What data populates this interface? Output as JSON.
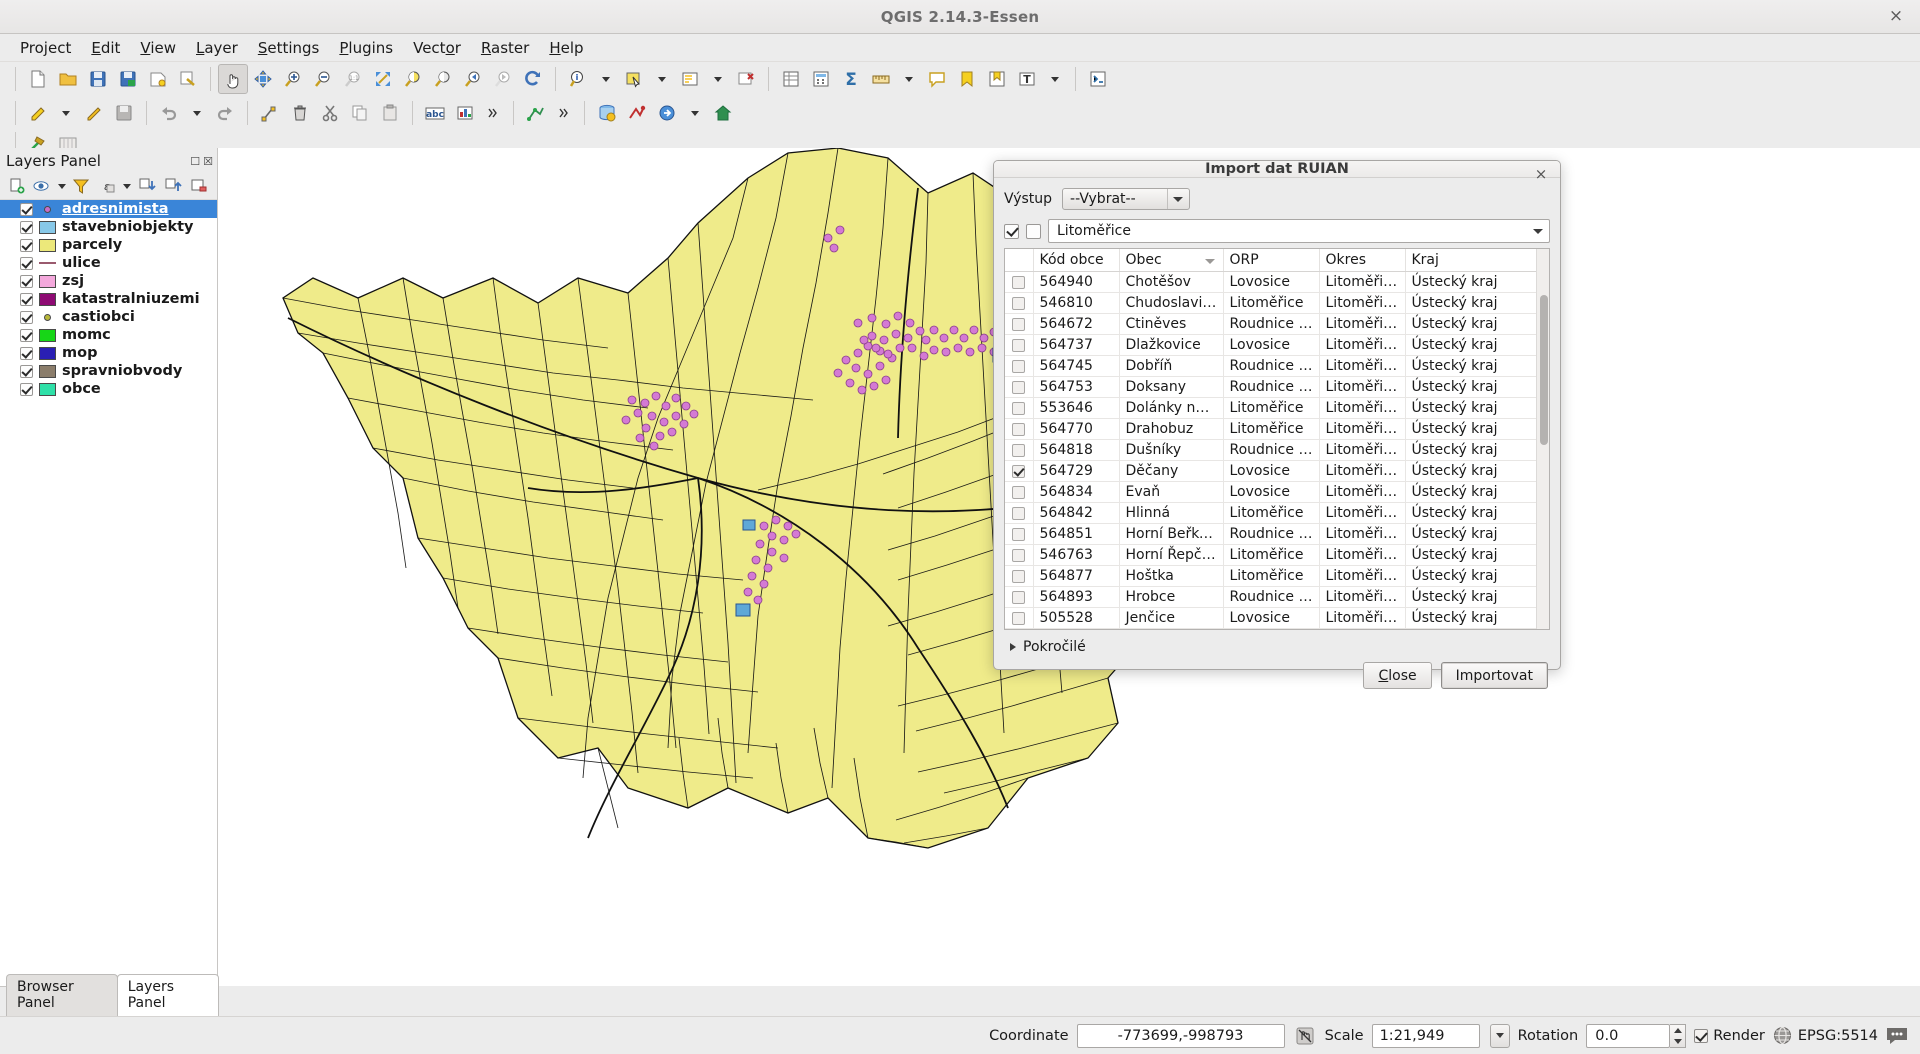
{
  "window": {
    "title": "QGIS 2.14.3-Essen",
    "close_label": "×"
  },
  "menubar": {
    "items": [
      {
        "label": "Project",
        "accel": "j"
      },
      {
        "label": "Edit",
        "accel": "E"
      },
      {
        "label": "View",
        "accel": "V"
      },
      {
        "label": "Layer",
        "accel": "L"
      },
      {
        "label": "Settings",
        "accel": "S"
      },
      {
        "label": "Plugins",
        "accel": "P"
      },
      {
        "label": "Vector",
        "accel": "o"
      },
      {
        "label": "Raster",
        "accel": "R"
      },
      {
        "label": "Help",
        "accel": "H"
      }
    ]
  },
  "toolbar_row1": {
    "icons": [
      "new-project-icon",
      "open-project-icon",
      "save-project-icon",
      "save-project-as-icon",
      "new-print-composer-icon",
      "composer-manager-icon",
      "pan-map-icon",
      "pan-to-selection-icon",
      "zoom-in-icon",
      "zoom-out-icon",
      "zoom-full-icon",
      "zoom-native-icon",
      "zoom-to-selection-icon",
      "zoom-to-layer-icon",
      "zoom-last-icon",
      "zoom-next-icon",
      "refresh-icon",
      "identify-features-icon",
      "measure-icon",
      "select-features-icon",
      "deselect-icon",
      "open-attribute-table-icon",
      "open-field-calculator-icon",
      "statistical-summary-icon",
      "measure-line-icon",
      "map-tips-icon",
      "new-bookmark-icon",
      "show-bookmarks-icon",
      "text-annotation-icon",
      "python-console-icon"
    ]
  },
  "toolbar_row2": {
    "icons": [
      "current-edits-icon",
      "toggle-editing-icon",
      "save-layer-edits-icon",
      "undo-icon",
      "redo-icon",
      "vertex-tool-icon",
      "delete-selected-icon",
      "cut-features-icon",
      "copy-features-icon",
      "paste-features-icon",
      "label-icon",
      "diagram-icon",
      "more-labeling-icon",
      "digitize-node-icon",
      "advanced-digitizing-icon",
      "db-manager-icon",
      "ruian-import-icon",
      "offline-editing-icon",
      "home-icon"
    ]
  },
  "toolbar_row3": {
    "icons": [
      "plugin-hammer-icon",
      "raster-terrain-icon"
    ]
  },
  "layers_panel": {
    "title": "Layers Panel",
    "toolbar_icons": [
      "add-layer-group-icon",
      "manage-layer-visibility-icon",
      "filter-legend-icon",
      "filter-legend-expression-icon",
      "expand-all-icon",
      "collapse-all-icon",
      "remove-layer-icon"
    ],
    "layers": [
      {
        "name": "adresnimista",
        "symbol": "dot",
        "color": "#c86ec8",
        "checked": true,
        "selected": true
      },
      {
        "name": "stavebniobjekty",
        "symbol": "box",
        "color": "#87c8e8",
        "checked": true,
        "selected": false
      },
      {
        "name": "parcely",
        "symbol": "box",
        "color": "#ece87a",
        "checked": true,
        "selected": false
      },
      {
        "name": "ulice",
        "symbol": "line",
        "color": "#9a5a6e",
        "checked": true,
        "selected": false
      },
      {
        "name": "zsj",
        "symbol": "box",
        "color": "#f4a8dc",
        "checked": true,
        "selected": false
      },
      {
        "name": "katastralniuzemi",
        "symbol": "box",
        "color": "#8e0a73",
        "checked": true,
        "selected": false
      },
      {
        "name": "castiobci",
        "symbol": "dot",
        "color": "#b8b83a",
        "checked": true,
        "selected": false
      },
      {
        "name": "momc",
        "symbol": "box",
        "color": "#17d617",
        "checked": true,
        "selected": false
      },
      {
        "name": "mop",
        "symbol": "box",
        "color": "#2a1fb4",
        "checked": true,
        "selected": false
      },
      {
        "name": "spravniobvody",
        "symbol": "box",
        "color": "#8b7d6b",
        "checked": true,
        "selected": false
      },
      {
        "name": "obce",
        "symbol": "box",
        "color": "#2fe0a8",
        "checked": true,
        "selected": false
      }
    ]
  },
  "panel_tabs": [
    {
      "label": "Browser Panel",
      "active": false
    },
    {
      "label": "Layers Panel",
      "active": true
    }
  ],
  "dialog": {
    "title": "Import dat RUIAN",
    "close_label": "×",
    "output_label": "Výstup",
    "output_value": "--Vybrat--",
    "select_all_checked": true,
    "select_none_checked": false,
    "search_value": "Litoměřice",
    "columns": [
      "",
      "Kód obce",
      "Obec",
      "ORP",
      "Okres",
      "Kraj"
    ],
    "sorted_column": "Obec",
    "rows": [
      {
        "checked": false,
        "kod": "564940",
        "obec": "Chotěšov",
        "orp": "Lovosice",
        "okres": "Litoměřice",
        "kraj": "Ústecký kraj"
      },
      {
        "checked": false,
        "kod": "546810",
        "obec": "Chudoslavice",
        "orp": "Litoměřice",
        "okres": "Litoměřice",
        "kraj": "Ústecký kraj"
      },
      {
        "checked": false,
        "kod": "564672",
        "obec": "Ctiněves",
        "orp": "Roudnice na...",
        "okres": "Litoměřice",
        "kraj": "Ústecký kraj"
      },
      {
        "checked": false,
        "kod": "564737",
        "obec": "Dlažkovice",
        "orp": "Lovosice",
        "okres": "Litoměřice",
        "kraj": "Ústecký kraj"
      },
      {
        "checked": false,
        "kod": "564745",
        "obec": "Dobříň",
        "orp": "Roudnice na...",
        "okres": "Litoměřice",
        "kraj": "Ústecký kraj"
      },
      {
        "checked": false,
        "kod": "564753",
        "obec": "Doksany",
        "orp": "Roudnice na...",
        "okres": "Litoměřice",
        "kraj": "Ústecký kraj"
      },
      {
        "checked": false,
        "kod": "553646",
        "obec": "Dolánky na...",
        "orp": "Litoměřice",
        "okres": "Litoměřice",
        "kraj": "Ústecký kraj"
      },
      {
        "checked": false,
        "kod": "564770",
        "obec": "Drahobuz",
        "orp": "Litoměřice",
        "okres": "Litoměřice",
        "kraj": "Ústecký kraj"
      },
      {
        "checked": false,
        "kod": "564818",
        "obec": "Dušníky",
        "orp": "Roudnice na...",
        "okres": "Litoměřice",
        "kraj": "Ústecký kraj"
      },
      {
        "checked": true,
        "kod": "564729",
        "obec": "Děčany",
        "orp": "Lovosice",
        "okres": "Litoměřice",
        "kraj": "Ústecký kraj"
      },
      {
        "checked": false,
        "kod": "564834",
        "obec": "Evaň",
        "orp": "Lovosice",
        "okres": "Litoměřice",
        "kraj": "Ústecký kraj"
      },
      {
        "checked": false,
        "kod": "564842",
        "obec": "Hlinná",
        "orp": "Litoměřice",
        "okres": "Litoměřice",
        "kraj": "Ústecký kraj"
      },
      {
        "checked": false,
        "kod": "564851",
        "obec": "Horní Beřko...",
        "orp": "Roudnice na...",
        "okres": "Litoměřice",
        "kraj": "Ústecký kraj"
      },
      {
        "checked": false,
        "kod": "546763",
        "obec": "Horní Řepčice",
        "orp": "Litoměřice",
        "okres": "Litoměřice",
        "kraj": "Ústecký kraj"
      },
      {
        "checked": false,
        "kod": "564877",
        "obec": "Hoštka",
        "orp": "Litoměřice",
        "okres": "Litoměřice",
        "kraj": "Ústecký kraj"
      },
      {
        "checked": false,
        "kod": "564893",
        "obec": "Hrobce",
        "orp": "Roudnice na...",
        "okres": "Litoměřice",
        "kraj": "Ústecký kraj"
      },
      {
        "checked": false,
        "kod": "505528",
        "obec": "Jenčice",
        "orp": "Lovosice",
        "okres": "Litoměřice",
        "kraj": "Ústecký kraj"
      }
    ],
    "advanced_label": "Pokročilé",
    "close_button": "Close",
    "close_button_accel": "C",
    "import_button": "Importovat"
  },
  "statusbar": {
    "coordinate_label": "Coordinate",
    "coordinate_value": "-773699,-998793",
    "toggle_extents_icon": "toggle-extents-icon",
    "scale_label": "Scale",
    "scale_value": "1:21,949",
    "rotation_label": "Rotation",
    "rotation_value": "0.0",
    "render_label": "Render",
    "render_checked": true,
    "epsg_label": "EPSG:5514",
    "messages_icon": "messages-icon"
  },
  "map": {
    "parcel_fill": "#efeb8a",
    "parcel_stroke": "#111111",
    "point_color": "#d47ad4",
    "building_color": "#5fa8d8",
    "background": "#ffffff"
  }
}
